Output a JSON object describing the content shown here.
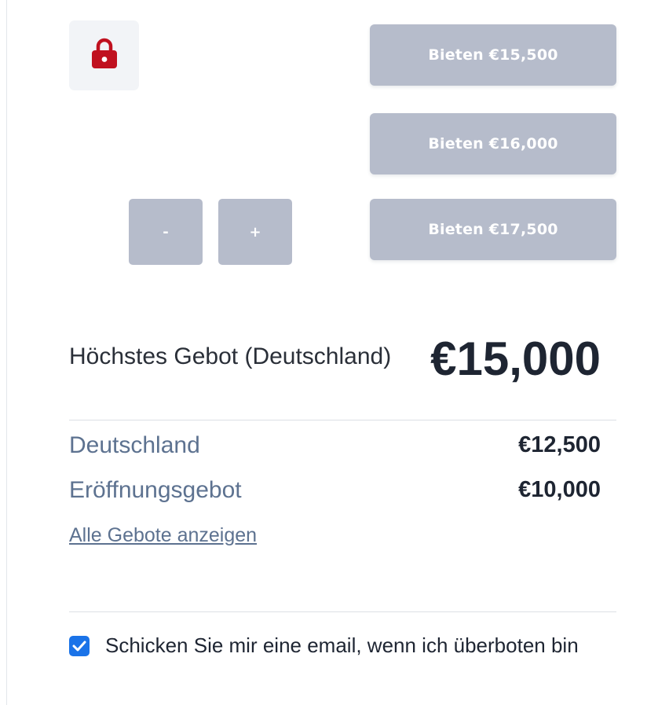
{
  "lock": {
    "icon": "lock-icon",
    "color": "#c0111f"
  },
  "bid_buttons": [
    {
      "label": "Bieten €15,500"
    },
    {
      "label": "Bieten €16,000"
    },
    {
      "label": "Bieten €17,500"
    }
  ],
  "stepper": {
    "minus_label": "-",
    "plus_label": "+"
  },
  "highest_bid": {
    "label": "Höchstes Gebot (Deutschland)",
    "value": "€15,000"
  },
  "bid_history": [
    {
      "label": "Deutschland",
      "value": "€12,500"
    },
    {
      "label": "Eröffnungsgebot",
      "value": "€10,000"
    }
  ],
  "all_bids_link": "Alle Gebote anzeigen",
  "email_notify": {
    "label": "Schicken Sie mir eine email, wenn ich überboten bin",
    "checked": true
  },
  "colors": {
    "button_bg": "#b6bccb",
    "label_muted": "#5d7290",
    "checkbox_accent": "#1a73e8"
  }
}
